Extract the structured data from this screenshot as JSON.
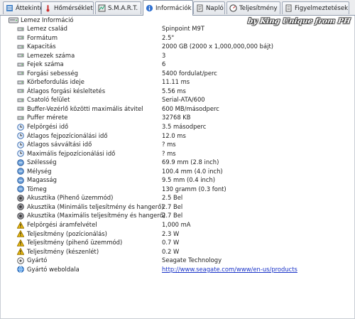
{
  "tabs": [
    {
      "label": "Áttekintés",
      "icon": "overview-icon",
      "active": false
    },
    {
      "label": "Hőmérséklet",
      "icon": "temperature-icon",
      "active": false
    },
    {
      "label": "S.M.A.R.T.",
      "icon": "smart-icon",
      "active": false
    },
    {
      "label": "Információk",
      "icon": "info-icon",
      "active": true
    },
    {
      "label": "Napló",
      "icon": "log-icon",
      "active": false
    },
    {
      "label": "Teljesítmény",
      "icon": "performance-icon",
      "active": false
    },
    {
      "label": "Figyelmeztetések",
      "icon": "warnings-icon",
      "active": false
    }
  ],
  "watermark": "by King Unique from PH",
  "group": {
    "title": "Lemez Információ",
    "icon": "drive-icon"
  },
  "rows": [
    {
      "label": "Lemez család",
      "value": "Spinpoint M9T",
      "icon": "property-icon"
    },
    {
      "label": "Formátum",
      "value": "2.5\"",
      "icon": "property-icon"
    },
    {
      "label": "Kapacitás",
      "value": "2000 GB (2000 x 1,000,000,000 bájt)",
      "icon": "property-icon"
    },
    {
      "label": "Lemezek száma",
      "value": "3",
      "icon": "property-icon"
    },
    {
      "label": "Fejek száma",
      "value": "6",
      "icon": "property-icon"
    },
    {
      "label": "Forgási sebesség",
      "value": "5400 fordulat/perc",
      "icon": "property-icon"
    },
    {
      "label": "Körbefordulás ideje",
      "value": "11.11 ms",
      "icon": "property-icon"
    },
    {
      "label": "Átlagos forgási késleltetés",
      "value": "5.56 ms",
      "icon": "property-icon"
    },
    {
      "label": "Csatoló felület",
      "value": "Serial-ATA/600",
      "icon": "property-icon"
    },
    {
      "label": "Buffer-Vezérlő közötti maximális átvitel",
      "value": "600 MB/másodperc",
      "icon": "property-icon"
    },
    {
      "label": "Puffer mérete",
      "value": "32768 KB",
      "icon": "property-icon"
    },
    {
      "label": "Felpörgési idő",
      "value": "3.5 másodperc",
      "icon": "clock-icon"
    },
    {
      "label": "Átlagos fejpozícionálási idő",
      "value": "12.0 ms",
      "icon": "clock-icon"
    },
    {
      "label": "Átlagos sávváltási idő",
      "value": "? ms",
      "icon": "clock-icon"
    },
    {
      "label": "Maximális fejpozícionálási idő",
      "value": "? ms",
      "icon": "clock-icon"
    },
    {
      "label": "Szélesség",
      "value": "69.9 mm (2.8 inch)",
      "icon": "dimension-icon"
    },
    {
      "label": "Mélység",
      "value": "100.4 mm (4.0 inch)",
      "icon": "dimension-icon"
    },
    {
      "label": "Magasság",
      "value": "9.5 mm (0.4 inch)",
      "icon": "dimension-icon"
    },
    {
      "label": "Tömeg",
      "value": "130 gramm (0.3 font)",
      "icon": "dimension-icon"
    },
    {
      "label": "Akusztika (Pihenő üzemmód)",
      "value": "2.5 Bel",
      "icon": "acoustics-icon"
    },
    {
      "label": "Akusztika (Minimális teljesítmény és hangerő)",
      "value": "2.7 Bel",
      "icon": "acoustics-icon"
    },
    {
      "label": "Akusztika (Maximális teljesítmény és hangerő)",
      "value": "2.7 Bel",
      "icon": "acoustics-icon"
    },
    {
      "label": "Felpörgési áramfelvétel",
      "value": "1,000 mA",
      "icon": "power-warning-icon"
    },
    {
      "label": "Teljesítmény (pozícionálás)",
      "value": "2.3 W",
      "icon": "power-warning-icon"
    },
    {
      "label": "Teljesítmény (pihenő üzemmód)",
      "value": "0.7 W",
      "icon": "power-warning-icon"
    },
    {
      "label": "Teljesítmény (készenlét)",
      "value": "0.2 W",
      "icon": "power-warning-icon"
    },
    {
      "label": "Gyártó",
      "value": "Seagate Technology",
      "icon": "manufacturer-icon"
    },
    {
      "label": "Gyártó weboldala",
      "value": "http://www.seagate.com/www/en-us/products",
      "icon": "globe-icon",
      "link": true
    }
  ]
}
